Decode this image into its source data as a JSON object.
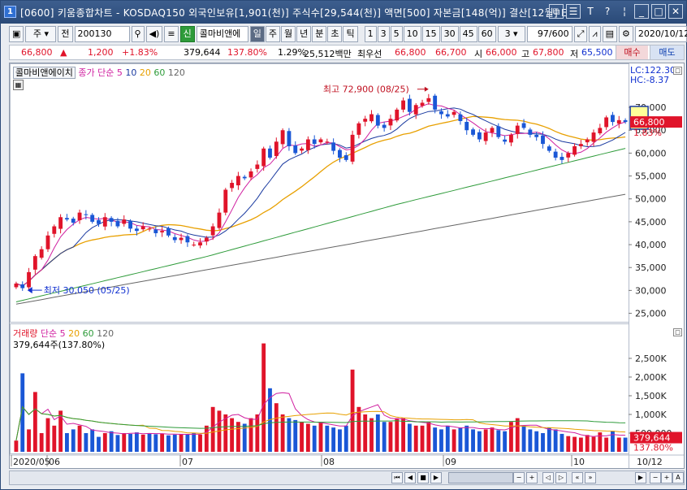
{
  "window": {
    "title": "[0600] 키움종합차트 - KOSDAQ150 외국인보유[1,901(천)] 주식수[29,544(천)] 액면[500] 자본금[148(억)] 결산[12월] E",
    "app_icon": "1"
  },
  "toolbar": {
    "period_type": "주",
    "prev_label": "전",
    "code": "200130",
    "stock_name": "콜마비앤에",
    "new_badge": "신",
    "periods": [
      "일",
      "주",
      "월",
      "년",
      "분",
      "초",
      "틱"
    ],
    "active_period": "일",
    "intervals": [
      "1",
      "3",
      "5",
      "10",
      "15",
      "30",
      "45",
      "60"
    ],
    "interval_select": "3",
    "count": "97/600",
    "date": "2020/10/12"
  },
  "quote": {
    "price": "66,800",
    "change": "1,200",
    "change_rate": "+1.83%",
    "volume": "379,644",
    "volume_rate": "137.80%",
    "turnover": "1.29%",
    "amount": "25,512백만",
    "priority_label": "최우선",
    "ask": "66,800",
    "bid": "66,700",
    "open_label": "시",
    "open": "66,000",
    "high_label": "고",
    "high": "67,800",
    "low_label": "저",
    "low": "65,500",
    "buy_label": "매수",
    "sell_label": "매도"
  },
  "price_panel": {
    "stock_label": "콜마비앤에이치",
    "ma_legend": {
      "label": "종가 단순",
      "periods": [
        "5",
        "10",
        "20",
        "60",
        "120"
      ]
    },
    "lc": "LC:122.30",
    "hc": "HC:-8.37",
    "current_label": "66,800",
    "current_rate": "1.83%",
    "high_annotation": "최고 72,900 (08/25)",
    "low_annotation": "최저 30,050 (05/25)"
  },
  "volume_panel": {
    "legend_label": "거래량",
    "ma_label": "단순",
    "ma_periods": [
      "5",
      "20",
      "60",
      "120"
    ],
    "current_volume": "379,644주(137.80%)",
    "current_label": "379,644",
    "current_rate": "137.80%"
  },
  "x_axis_labels": [
    "2020/05",
    "06",
    "07",
    "08",
    "09",
    "10",
    "10/12"
  ],
  "colors": {
    "up": "#e0142a",
    "down": "#1a57d6",
    "ma5": "#d020a0",
    "ma10": "#1a3aa0",
    "ma20": "#e8a000",
    "ma60": "#2e9b3a",
    "ma120": "#666666"
  },
  "chart_data": {
    "type": "candlestick",
    "price_axis": {
      "min": 25000,
      "max": 70000,
      "ticks": [
        25000,
        30000,
        35000,
        40000,
        45000,
        50000,
        55000,
        60000,
        65000,
        70000
      ]
    },
    "price_tick_labels": [
      "25,000",
      "30,000",
      "35,000",
      "40,000",
      "45,000",
      "50,000",
      "55,000",
      "60,000",
      "65,000",
      "70,000"
    ],
    "volume_axis": {
      "ticks": [
        500000,
        1000000,
        1500000,
        2000000,
        2500000
      ]
    },
    "volume_tick_labels": [
      "500,000",
      "1,000K",
      "1,500K",
      "2,000K",
      "2,500K"
    ],
    "closes": [
      31500,
      30500,
      34000,
      37500,
      39000,
      42000,
      44000,
      46000,
      45500,
      44800,
      47000,
      46500,
      45000,
      44500,
      46000,
      45000,
      44000,
      45500,
      43500,
      43000,
      44000,
      43500,
      42500,
      43000,
      42000,
      41000,
      41500,
      40500,
      40000,
      40500,
      41500,
      44000,
      47000,
      52000,
      53500,
      55000,
      54500,
      56000,
      57500,
      61000,
      59000,
      62500,
      65000,
      61500,
      60000,
      61000,
      63000,
      62000,
      63000,
      62500,
      60500,
      59000,
      58500,
      64000,
      66500,
      67500,
      68500,
      66000,
      65500,
      67500,
      69500,
      71500,
      69000,
      70500,
      71000,
      72000,
      69500,
      68500,
      68000,
      69000,
      67000,
      65000,
      64000,
      63000,
      64500,
      65500,
      63500,
      62500,
      64000,
      66000,
      65500,
      64000,
      63500,
      62000,
      60500,
      59000,
      58500,
      60000,
      61500,
      62000,
      63000,
      64500,
      65500,
      67800,
      66800,
      67200,
      66800
    ],
    "volumes": [
      300000,
      2100000,
      600000,
      1600000,
      500000,
      900000,
      700000,
      1100000,
      500000,
      600000,
      700000,
      500000,
      600000,
      400000,
      500000,
      550000,
      450000,
      500000,
      480000,
      520000,
      460000,
      500000,
      470000,
      490000,
      440000,
      460000,
      480000,
      470000,
      500000,
      460000,
      700000,
      1200000,
      1100000,
      1000000,
      900000,
      800000,
      750000,
      900000,
      1000000,
      2900000,
      1700000,
      1300000,
      1000000,
      900000,
      850000,
      800000,
      750000,
      700000,
      800000,
      700000,
      650000,
      600000,
      700000,
      2200000,
      1200000,
      1000000,
      900000,
      1000000,
      800000,
      800000,
      900000,
      900000,
      750000,
      700000,
      700000,
      800000,
      650000,
      600000,
      700000,
      600000,
      650000,
      700000,
      600000,
      550000,
      600000,
      650000,
      580000,
      550000,
      800000,
      900000,
      700000,
      600000,
      550000,
      500000,
      650000,
      600000,
      480000,
      420000,
      400000,
      380000,
      450000,
      400000,
      520000,
      380000,
      560000,
      380000,
      379644
    ]
  }
}
